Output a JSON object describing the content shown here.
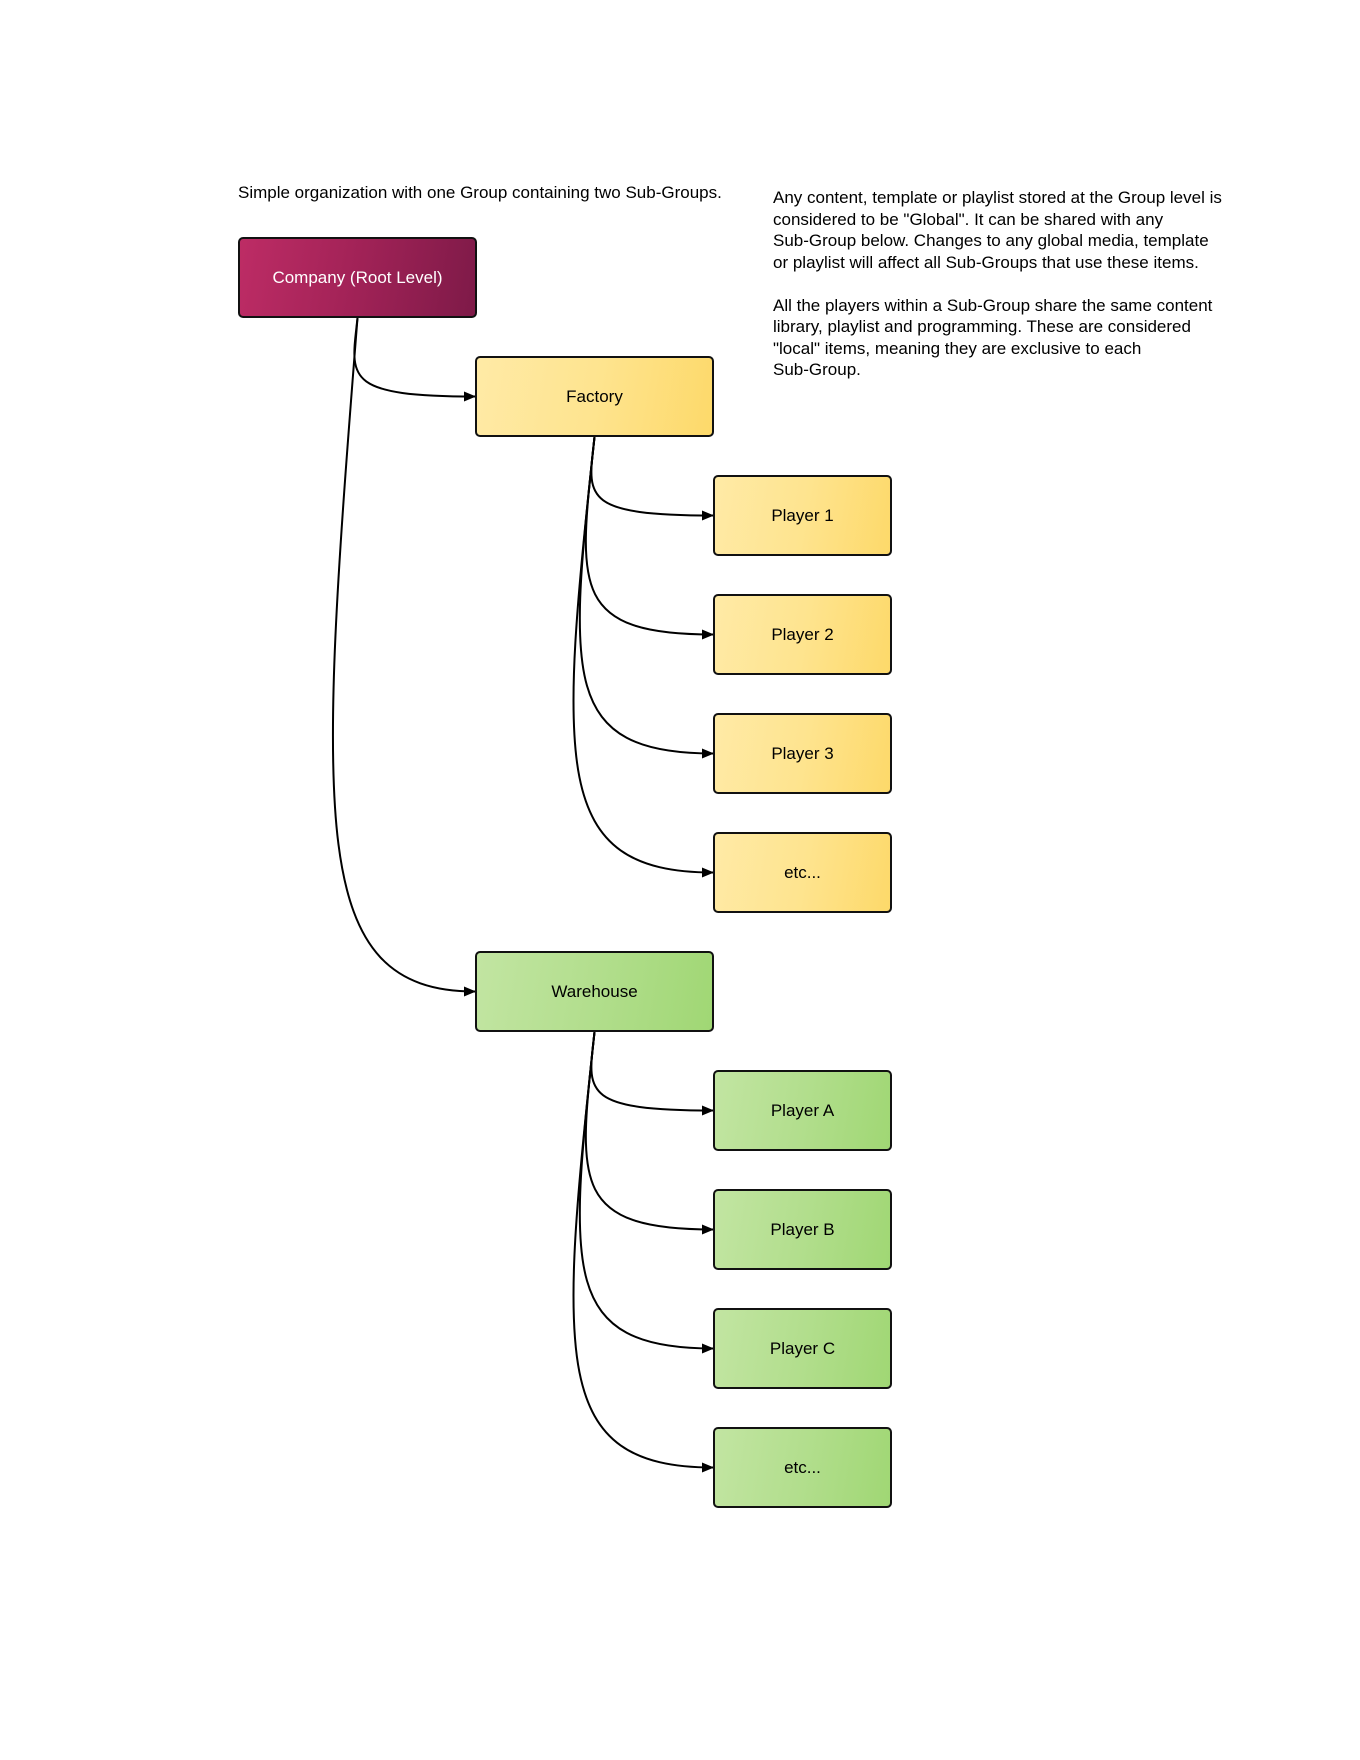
{
  "caption": "Simple organization with one Group containing two Sub-Groups.",
  "notes": {
    "paragraph1": [
      "Any content, template or playlist stored at the Group level is",
      "considered to be \"Global\".  It can be shared with any",
      "Sub-Group below.  Changes to any global media, template",
      "or playlist will affect all Sub-Groups that use these items."
    ],
    "paragraph2": [
      "All the players within a Sub-Group share the same content",
      "library, playlist and programming.  These are considered",
      "\"local\" items, meaning they are exclusive to each",
      "Sub-Group."
    ]
  },
  "colors": {
    "root": "#a42358",
    "factory_group": "#fee48f",
    "warehouse_group": "#b2de8d",
    "edges": "#000000"
  },
  "tree": {
    "root": {
      "id": "company",
      "label": "Company (Root Level)"
    },
    "groups": [
      {
        "id": "factory",
        "label": "Factory",
        "theme": "yellow",
        "children": [
          {
            "id": "player-1",
            "label": "Player 1"
          },
          {
            "id": "player-2",
            "label": "Player 2"
          },
          {
            "id": "player-3",
            "label": "Player 3"
          },
          {
            "id": "factory-etc",
            "label": "etc..."
          }
        ]
      },
      {
        "id": "warehouse",
        "label": "Warehouse",
        "theme": "green",
        "children": [
          {
            "id": "player-a",
            "label": "Player A"
          },
          {
            "id": "player-b",
            "label": "Player B"
          },
          {
            "id": "player-c",
            "label": "Player C"
          },
          {
            "id": "warehouse-etc",
            "label": "etc..."
          }
        ]
      }
    ]
  }
}
